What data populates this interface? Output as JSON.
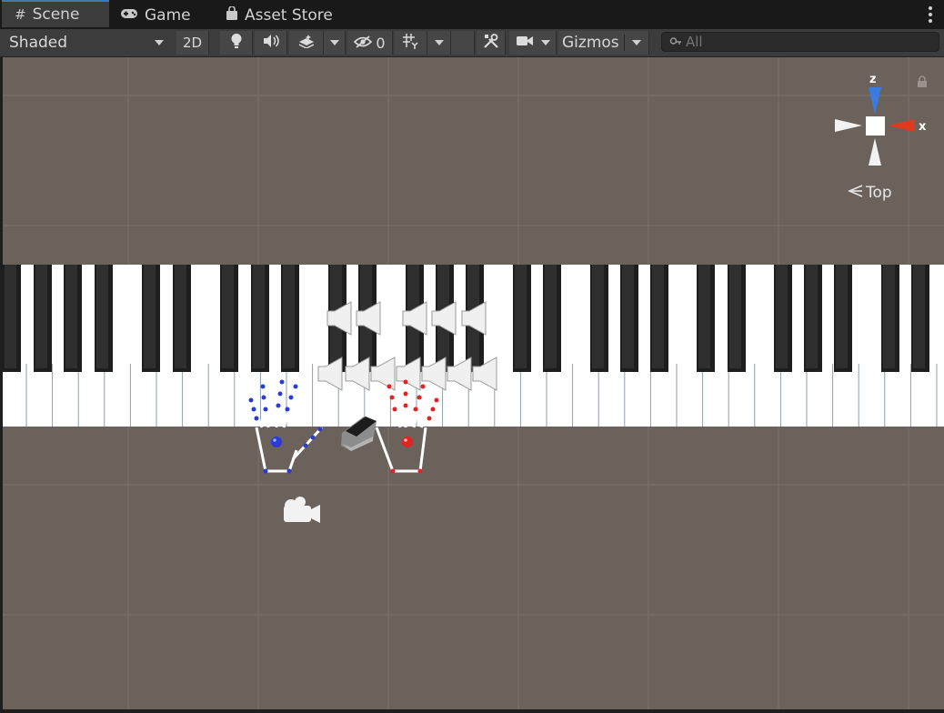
{
  "tabs": [
    {
      "label": "Scene",
      "icon": "grid-hash-icon",
      "active": true
    },
    {
      "label": "Game",
      "icon": "gamepad-icon",
      "active": false
    },
    {
      "label": "Asset Store",
      "icon": "shopping-bag-icon",
      "active": false
    }
  ],
  "toolbar": {
    "draw_mode": "Shaded",
    "two_d_label": "2D",
    "hidden_count": "0",
    "gizmos_label": "Gizmos"
  },
  "search": {
    "placeholder": "All"
  },
  "orientation": {
    "view_label": "Top",
    "axis_z": "z",
    "axis_x": "x"
  },
  "colors": {
    "tab_active_accent": "#3a79bb",
    "viewport_bg": "#6c625c",
    "left_hand": "#2a3bd6",
    "right_hand": "#e02424",
    "axis_x": "#e0391e",
    "axis_z": "#3a7be0"
  }
}
